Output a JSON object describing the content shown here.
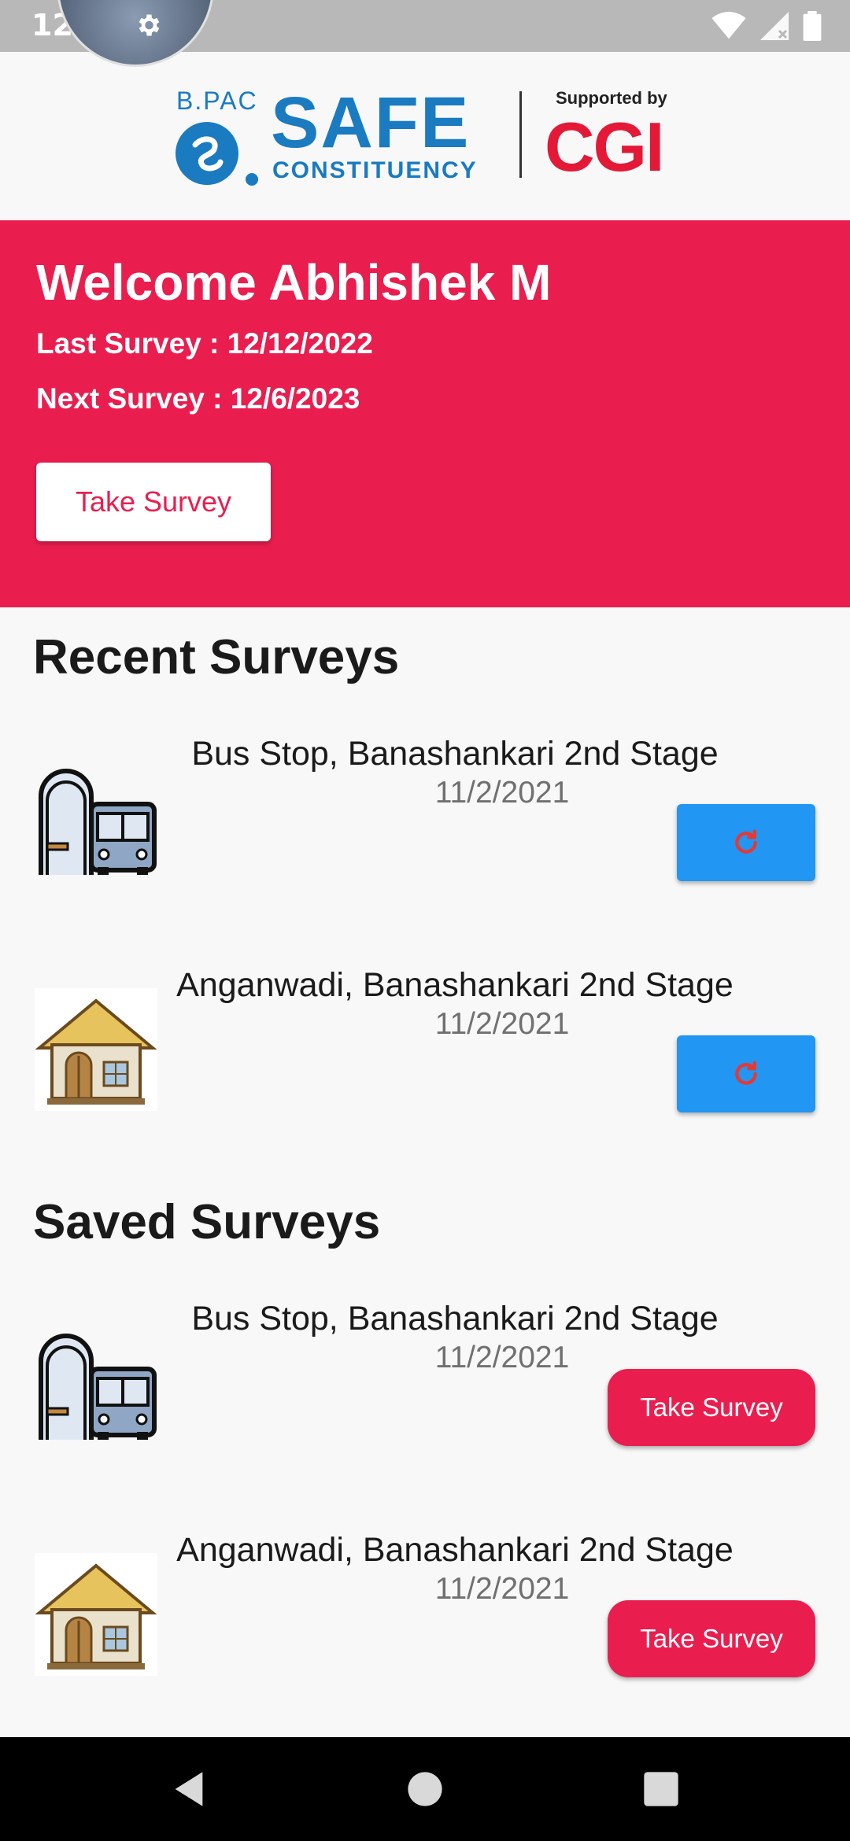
{
  "status_bar": {
    "time": "12:51"
  },
  "header": {
    "logo": {
      "bpac": "B.PAC",
      "safe": "SAFE",
      "constituency": "CONSTITUENCY",
      "supported_by": "Supported by",
      "cgi": "CGI"
    }
  },
  "welcome": {
    "title": "Welcome Abhishek M",
    "last_survey": "Last Survey : 12/12/2022",
    "next_survey": "Next Survey : 12/6/2023",
    "button_label": "Take Survey"
  },
  "recent_surveys": {
    "title": "Recent Surveys",
    "items": [
      {
        "place": "Bus Stop, Banashankari 2nd Stage",
        "date": "11/2/2021",
        "icon": "bus-stop-icon",
        "action_icon": "retry-icon"
      },
      {
        "place": "Anganwadi, Banashankari 2nd Stage",
        "date": "11/2/2021",
        "icon": "anganwadi-icon",
        "action_icon": "retry-icon"
      }
    ]
  },
  "saved_surveys": {
    "title": "Saved Surveys",
    "items": [
      {
        "place": "Bus Stop, Banashankari 2nd Stage",
        "date": "11/2/2021",
        "icon": "bus-stop-icon",
        "action_label": "Take Survey"
      },
      {
        "place": "Anganwadi, Banashankari 2nd Stage",
        "date": "11/2/2021",
        "icon": "anganwadi-icon",
        "action_label": "Take Survey"
      }
    ]
  },
  "colors": {
    "accent": "#e91e4f",
    "primary_blue": "#2196f3",
    "logo_blue": "#1a7bc1",
    "cgi_red": "#e31937"
  }
}
